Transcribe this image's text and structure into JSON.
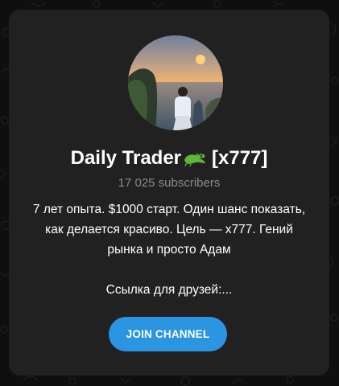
{
  "channel": {
    "title": "Daily Trader",
    "title_emoji": "crocodile-icon",
    "title_suffix": "[x777]",
    "subscribers": "17 025 subscribers",
    "description_lines": [
      "7 лет опыта. $1000 старт. Один шанс показать,",
      "как делается красиво. Цель — x777. Гений",
      "рынка и просто Адам"
    ],
    "link_line": "Ссылка для друзей:..."
  },
  "actions": {
    "join_label": "JOIN CHANNEL"
  },
  "colors": {
    "background": "#0f0f0f",
    "card": "#212121",
    "accent": "#2b95e2",
    "text_primary": "#ffffff",
    "text_secondary": "#8b8b8b"
  }
}
